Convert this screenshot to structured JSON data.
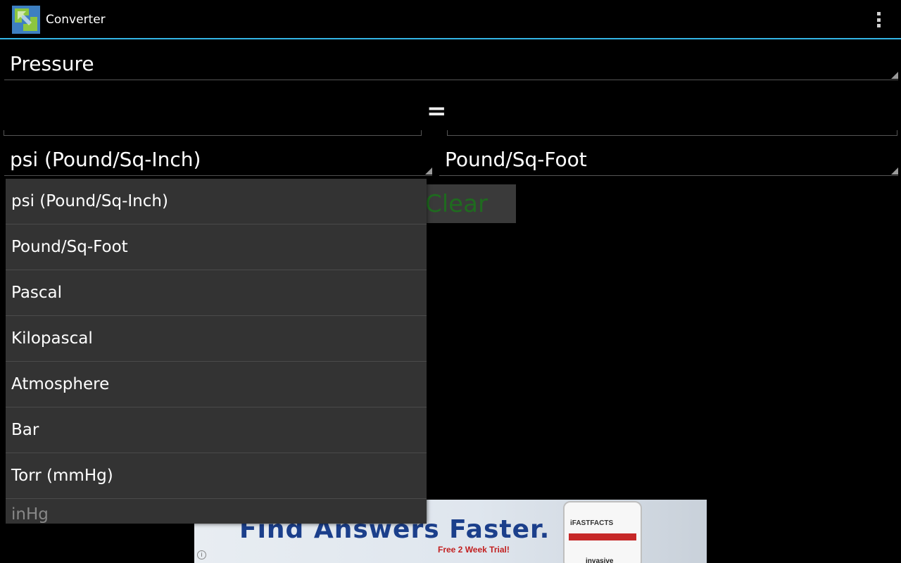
{
  "app": {
    "title": "Converter",
    "icon": "converter-app-icon",
    "overflow_icon": "overflow-menu-icon"
  },
  "category": {
    "selected": "Pressure"
  },
  "conversion": {
    "from_value": "",
    "to_value": "",
    "equals_symbol": "="
  },
  "from_unit": {
    "selected": "psi (Pound/Sq-Inch)"
  },
  "to_unit": {
    "selected": "Pound/Sq-Foot"
  },
  "clear_button": {
    "label": "Clear"
  },
  "dropdown": {
    "items": [
      "psi (Pound/Sq-Inch)",
      "Pound/Sq-Foot",
      "Pascal",
      "Kilopascal",
      "Atmosphere",
      "Bar",
      "Torr (mmHg)",
      "inHg"
    ]
  },
  "ad": {
    "headline": "Find Answers Faster.",
    "subline": "Free 2 Week Trial!",
    "phone_brand": "iFASTFACTS",
    "phone_word": "invasive",
    "info_icon": "info-icon"
  },
  "colors": {
    "accent": "#33b5e5",
    "background": "#000000",
    "dropdown_bg": "#333333",
    "clear_text": "#1f6b1f"
  }
}
